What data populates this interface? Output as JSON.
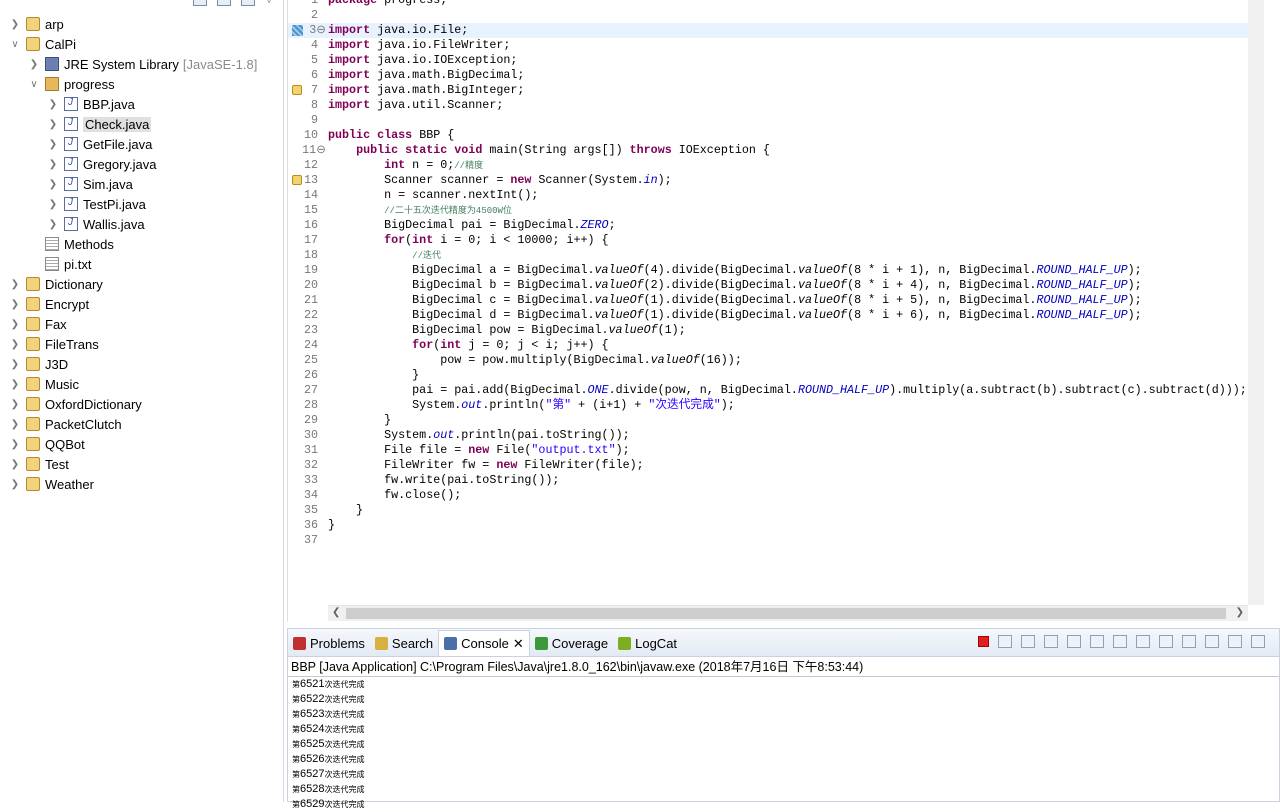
{
  "explorer": {
    "items": [
      {
        "label": "arp",
        "level": 0,
        "icon": "project",
        "expanded": false
      },
      {
        "label": "CalPi",
        "level": 0,
        "icon": "project",
        "expanded": true
      },
      {
        "label": "JRE System Library",
        "suffix": "[JavaSE-1.8]",
        "level": 1,
        "icon": "library",
        "expanded": false
      },
      {
        "label": "progress",
        "level": 1,
        "icon": "package",
        "expanded": true
      },
      {
        "label": "BBP.java",
        "level": 2,
        "icon": "java-file",
        "expanded": false
      },
      {
        "label": "Check.java",
        "level": 2,
        "icon": "java-file",
        "expanded": false,
        "selected": true
      },
      {
        "label": "GetFile.java",
        "level": 2,
        "icon": "java-file",
        "expanded": false
      },
      {
        "label": "Gregory.java",
        "level": 2,
        "icon": "java-file",
        "expanded": false
      },
      {
        "label": "Sim.java",
        "level": 2,
        "icon": "java-file",
        "expanded": false
      },
      {
        "label": "TestPi.java",
        "level": 2,
        "icon": "java-file",
        "expanded": false
      },
      {
        "label": "Wallis.java",
        "level": 2,
        "icon": "java-file",
        "expanded": false
      },
      {
        "label": "Methods",
        "level": 1,
        "icon": "text-file",
        "leaf": true
      },
      {
        "label": "pi.txt",
        "level": 1,
        "icon": "text-file",
        "leaf": true
      },
      {
        "label": "Dictionary",
        "level": 0,
        "icon": "project",
        "expanded": false
      },
      {
        "label": "Encrypt",
        "level": 0,
        "icon": "project",
        "expanded": false
      },
      {
        "label": "Fax",
        "level": 0,
        "icon": "project",
        "expanded": false
      },
      {
        "label": "FileTrans",
        "level": 0,
        "icon": "project",
        "expanded": false
      },
      {
        "label": "J3D",
        "level": 0,
        "icon": "project",
        "expanded": false
      },
      {
        "label": "Music",
        "level": 0,
        "icon": "project",
        "expanded": false
      },
      {
        "label": "OxfordDictionary",
        "level": 0,
        "icon": "project",
        "expanded": false
      },
      {
        "label": "PacketClutch",
        "level": 0,
        "icon": "project",
        "expanded": false
      },
      {
        "label": "QQBot",
        "level": 0,
        "icon": "project",
        "expanded": false
      },
      {
        "label": "Test",
        "level": 0,
        "icon": "project",
        "expanded": false
      },
      {
        "label": "Weather",
        "level": 0,
        "icon": "project",
        "expanded": false
      }
    ]
  },
  "editor": {
    "current_line": 3,
    "warning_lines": [
      7,
      13
    ],
    "fold_lines": [
      3,
      11
    ],
    "lines": [
      [
        [
          "k",
          "package"
        ],
        [
          "p",
          " progress;"
        ]
      ],
      [],
      [
        [
          "k",
          "import"
        ],
        [
          "p",
          " java.io.File;"
        ]
      ],
      [
        [
          "k",
          "import"
        ],
        [
          "p",
          " java.io.FileWriter;"
        ]
      ],
      [
        [
          "k",
          "import"
        ],
        [
          "p",
          " java.io.IOException;"
        ]
      ],
      [
        [
          "k",
          "import"
        ],
        [
          "p",
          " java.math.BigDecimal;"
        ]
      ],
      [
        [
          "k",
          "import"
        ],
        [
          "p",
          " java.math.BigInteger;"
        ]
      ],
      [
        [
          "k",
          "import"
        ],
        [
          "p",
          " java.util.Scanner;"
        ]
      ],
      [],
      [
        [
          "k",
          "public"
        ],
        [
          "p",
          " "
        ],
        [
          "k",
          "class"
        ],
        [
          "p",
          " BBP {"
        ]
      ],
      [
        [
          "p",
          "    "
        ],
        [
          "k",
          "public"
        ],
        [
          "p",
          " "
        ],
        [
          "k",
          "static"
        ],
        [
          "p",
          " "
        ],
        [
          "k",
          "void"
        ],
        [
          "p",
          " main(String args[]) "
        ],
        [
          "k",
          "throws"
        ],
        [
          "p",
          " IOException {"
        ]
      ],
      [
        [
          "p",
          "        "
        ],
        [
          "k",
          "int"
        ],
        [
          "p",
          " n = 0;"
        ],
        [
          "c",
          "//精度"
        ]
      ],
      [
        [
          "p",
          "        Scanner scanner = "
        ],
        [
          "k",
          "new"
        ],
        [
          "p",
          " Scanner(System."
        ],
        [
          "f",
          "in"
        ],
        [
          "p",
          ");"
        ]
      ],
      [
        [
          "p",
          "        n = scanner.nextInt();"
        ]
      ],
      [
        [
          "p",
          "        "
        ],
        [
          "c",
          "//二十五次迭代精度为4500W位"
        ]
      ],
      [
        [
          "p",
          "        BigDecimal pai = BigDecimal."
        ],
        [
          "f",
          "ZERO"
        ],
        [
          "p",
          ";"
        ]
      ],
      [
        [
          "p",
          "        "
        ],
        [
          "k",
          "for"
        ],
        [
          "p",
          "("
        ],
        [
          "k",
          "int"
        ],
        [
          "p",
          " i = 0; i < 10000; i++) {"
        ]
      ],
      [
        [
          "p",
          "            "
        ],
        [
          "c",
          "//迭代"
        ]
      ],
      [
        [
          "p",
          "            BigDecimal a = BigDecimal."
        ],
        [
          "m",
          "valueOf"
        ],
        [
          "p",
          "(4).divide(BigDecimal."
        ],
        [
          "m",
          "valueOf"
        ],
        [
          "p",
          "(8 * i + 1), n, BigDecimal."
        ],
        [
          "f",
          "ROUND_HALF_UP"
        ],
        [
          "p",
          ");"
        ]
      ],
      [
        [
          "p",
          "            BigDecimal b = BigDecimal."
        ],
        [
          "m",
          "valueOf"
        ],
        [
          "p",
          "(2).divide(BigDecimal."
        ],
        [
          "m",
          "valueOf"
        ],
        [
          "p",
          "(8 * i + 4), n, BigDecimal."
        ],
        [
          "f",
          "ROUND_HALF_UP"
        ],
        [
          "p",
          ");"
        ]
      ],
      [
        [
          "p",
          "            BigDecimal c = BigDecimal."
        ],
        [
          "m",
          "valueOf"
        ],
        [
          "p",
          "(1).divide(BigDecimal."
        ],
        [
          "m",
          "valueOf"
        ],
        [
          "p",
          "(8 * i + 5), n, BigDecimal."
        ],
        [
          "f",
          "ROUND_HALF_UP"
        ],
        [
          "p",
          ");"
        ]
      ],
      [
        [
          "p",
          "            BigDecimal d = BigDecimal."
        ],
        [
          "m",
          "valueOf"
        ],
        [
          "p",
          "(1).divide(BigDecimal."
        ],
        [
          "m",
          "valueOf"
        ],
        [
          "p",
          "(8 * i + 6), n, BigDecimal."
        ],
        [
          "f",
          "ROUND_HALF_UP"
        ],
        [
          "p",
          ");"
        ]
      ],
      [
        [
          "p",
          "            BigDecimal pow = BigDecimal."
        ],
        [
          "m",
          "valueOf"
        ],
        [
          "p",
          "(1);"
        ]
      ],
      [
        [
          "p",
          "            "
        ],
        [
          "k",
          "for"
        ],
        [
          "p",
          "("
        ],
        [
          "k",
          "int"
        ],
        [
          "p",
          " j = 0; j < i; j++) {"
        ]
      ],
      [
        [
          "p",
          "                pow = pow.multiply(BigDecimal."
        ],
        [
          "m",
          "valueOf"
        ],
        [
          "p",
          "(16));"
        ]
      ],
      [
        [
          "p",
          "            }"
        ]
      ],
      [
        [
          "p",
          "            pai = pai.add(BigDecimal."
        ],
        [
          "f",
          "ONE"
        ],
        [
          "p",
          ".divide(pow, n, BigDecimal."
        ],
        [
          "f",
          "ROUND_HALF_UP"
        ],
        [
          "p",
          ").multiply(a.subtract(b).subtract(c).subtract(d)));"
        ]
      ],
      [
        [
          "p",
          "            System."
        ],
        [
          "f",
          "out"
        ],
        [
          "p",
          ".println("
        ],
        [
          "s",
          "\"第\""
        ],
        [
          "p",
          " + (i+1) + "
        ],
        [
          "s",
          "\"次迭代完成\""
        ],
        [
          "p",
          ");"
        ]
      ],
      [
        [
          "p",
          "        }"
        ]
      ],
      [
        [
          "p",
          "        System."
        ],
        [
          "f",
          "out"
        ],
        [
          "p",
          ".println(pai.toString());"
        ]
      ],
      [
        [
          "p",
          "        File file = "
        ],
        [
          "k",
          "new"
        ],
        [
          "p",
          " File("
        ],
        [
          "s",
          "\"output.txt\""
        ],
        [
          "p",
          ");"
        ]
      ],
      [
        [
          "p",
          "        FileWriter fw = "
        ],
        [
          "k",
          "new"
        ],
        [
          "p",
          " FileWriter(file);"
        ]
      ],
      [
        [
          "p",
          "        fw.write(pai.toString());"
        ]
      ],
      [
        [
          "p",
          "        fw.close();"
        ]
      ],
      [
        [
          "p",
          "    }"
        ]
      ],
      [
        [
          "p",
          "}"
        ]
      ],
      []
    ]
  },
  "console": {
    "tabs": [
      {
        "label": "Problems",
        "color": "#c03030"
      },
      {
        "label": "Search",
        "color": "#d8b040"
      },
      {
        "label": "Console",
        "active": true,
        "close": "✕",
        "color": "#4a6ea8"
      },
      {
        "label": "Coverage",
        "color": "#3a9a3a"
      },
      {
        "label": "LogCat",
        "color": "#7ab020"
      }
    ],
    "toolbar": [
      "terminate",
      "remove-launch",
      "remove-all",
      "clear-console",
      "scroll-lock",
      "word-wrap",
      "show-on-stdout",
      "show-on-stderr",
      "pin-console",
      "display-console",
      "open-console",
      "minimize",
      "maximize"
    ],
    "header": "BBP [Java Application] C:\\Program Files\\Java\\jre1.8.0_162\\bin\\javaw.exe (2018年7月16日 下午8:53:44)",
    "output": [
      {
        "prefix": "第",
        "num": "6521",
        "suffix": "次迭代完成"
      },
      {
        "prefix": "第",
        "num": "6522",
        "suffix": "次迭代完成"
      },
      {
        "prefix": "第",
        "num": "6523",
        "suffix": "次迭代完成"
      },
      {
        "prefix": "第",
        "num": "6524",
        "suffix": "次迭代完成"
      },
      {
        "prefix": "第",
        "num": "6525",
        "suffix": "次迭代完成"
      },
      {
        "prefix": "第",
        "num": "6526",
        "suffix": "次迭代完成"
      },
      {
        "prefix": "第",
        "num": "6527",
        "suffix": "次迭代完成"
      },
      {
        "prefix": "第",
        "num": "6528",
        "suffix": "次迭代完成"
      },
      {
        "prefix": "第",
        "num": "6529",
        "suffix": "次迭代完成"
      }
    ]
  },
  "colors": {
    "keyword": "#7f0055",
    "comment": "#3f7f5f",
    "string": "#2a00ff",
    "field": "#0000c0",
    "current_line": "#e8f2fe"
  }
}
